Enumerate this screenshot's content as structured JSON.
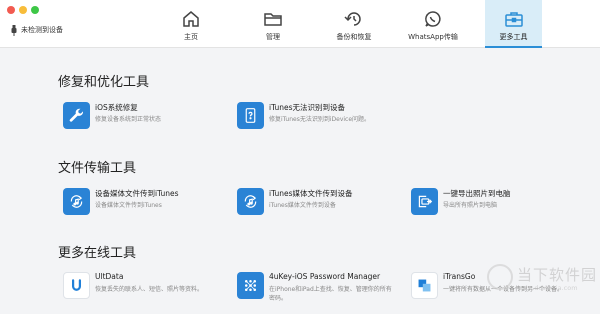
{
  "window": {
    "device_status": "未检测到设备"
  },
  "nav": {
    "tabs": [
      {
        "label": "主页",
        "icon": "home-icon"
      },
      {
        "label": "管理",
        "icon": "folder-icon"
      },
      {
        "label": "备份和恢复",
        "icon": "backup-restore-icon"
      },
      {
        "label": "WhatsApp传输",
        "icon": "whatsapp-icon"
      },
      {
        "label": "更多工具",
        "icon": "toolbox-icon",
        "active": true
      }
    ]
  },
  "sections": [
    {
      "title": "修复和优化工具",
      "tools": [
        {
          "title": "iOS系统修复",
          "desc": "修复设备系统到正常状态",
          "icon": "wrench-icon"
        },
        {
          "title": "iTunes无法识别到设备",
          "desc": "修复iTunes无法识别到iDevice问题。",
          "icon": "phone-question-icon"
        }
      ]
    },
    {
      "title": "文件传输工具",
      "tools": [
        {
          "title": "设备媒体文件传到iTunes",
          "desc": "设备媒体文件传到iTunes",
          "icon": "music-transfer-icon"
        },
        {
          "title": "iTunes媒体文件传到设备",
          "desc": "iTunes媒体文件传到设备",
          "icon": "music-transfer-icon"
        },
        {
          "title": "一键导出照片到电脑",
          "desc": "导出所有照片到电脑",
          "icon": "export-photo-icon"
        }
      ]
    },
    {
      "title": "更多在线工具",
      "tools": [
        {
          "title": "UltData",
          "desc": "恢复丢失的联系人、短信、照片等资料。",
          "icon": "ultdata-logo-icon"
        },
        {
          "title": "4uKey-iOS Password Manager",
          "desc": "在iPhone和iPad上查找、恢复、管理你的所有密码。",
          "icon": "4ukey-logo-icon"
        },
        {
          "title": "iTransGo",
          "desc": "一键将所有数据从一个设备传到另一个设备。",
          "icon": "itransgo-logo-icon"
        }
      ]
    }
  ],
  "watermark": {
    "brand": "当下软件园",
    "url": "www.downxia.com"
  },
  "colors": {
    "accent": "#2a83d5",
    "active_tab_bg": "#d9edf8",
    "background": "#f3f4f6"
  }
}
